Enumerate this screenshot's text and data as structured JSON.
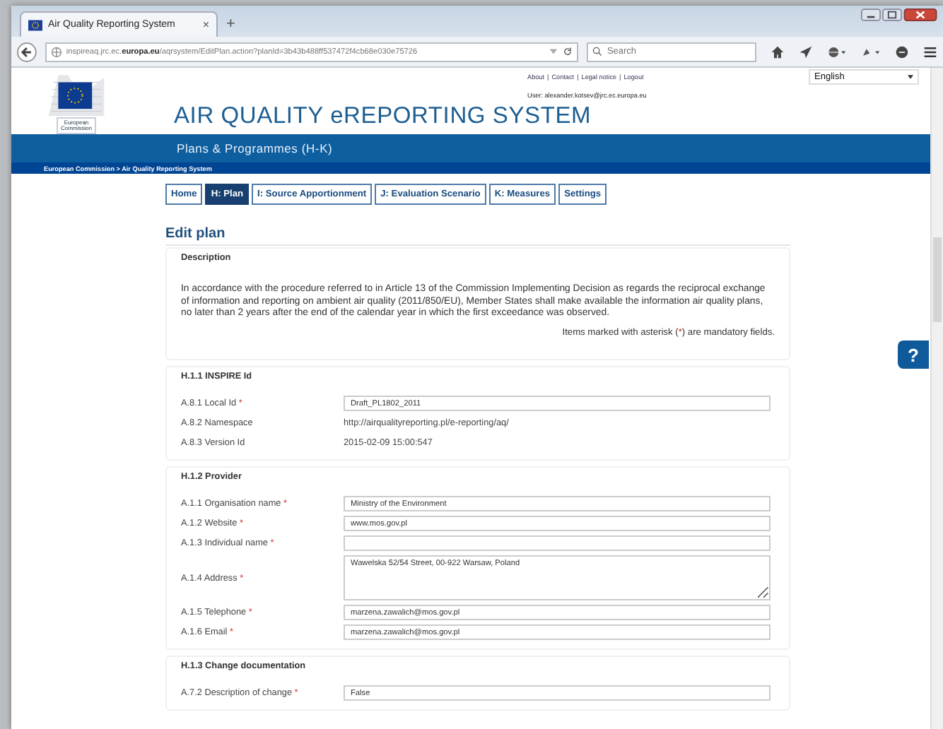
{
  "browser": {
    "tab_title": "Air Quality Reporting System",
    "tab_close": "×",
    "new_tab": "+",
    "url": "inspireaq.jrc.ec.**europa.eu**/aqrsystem/EditPlan.action?planId=3b43b488ff537472f4cb68e030e75726",
    "search_placeholder": "Search"
  },
  "header": {
    "links": [
      "About",
      "Contact",
      "Legal notice",
      "Logout"
    ],
    "link_separator": "|",
    "user": "User: alexander.kotsev@jrc.ec.europa.eu",
    "language": "English",
    "logo_text": "European Commission",
    "title": "AIR QUALITY eREPORTING SYSTEM",
    "subtitle": "Plans & Programmes (H-K)",
    "breadcrumb": "European Commission > Air Quality Reporting System"
  },
  "nav_tabs": [
    {
      "label": "Home",
      "selected": false
    },
    {
      "label": "H: Plan",
      "selected": true
    },
    {
      "label": "I: Source Apportionment",
      "selected": false
    },
    {
      "label": "J: Evaluation Scenario",
      "selected": false
    },
    {
      "label": "K: Measures",
      "selected": false
    },
    {
      "label": "Settings",
      "selected": false
    }
  ],
  "page_title": "Edit plan",
  "required_mark": "*",
  "sections": [
    {
      "kind": "text",
      "title": "Description",
      "paragraph": "In accordance with the procedure referred to in Article 13 of the Commission Implementing Decision as regards the reciprocal exchange of information and reporting on ambient air quality (2011/850/EU), Member States shall make available the information air quality plans, no later than 2 years after the end of the calendar year in which the first exceedance was observed.",
      "note": [
        "Items marked with asterisk (",
        "*",
        ") are mandatory fields."
      ]
    },
    {
      "kind": "fields",
      "title": "H.1.1 INSPIRE Id",
      "rows": [
        {
          "label": "A.8.1 Local Id",
          "required": true,
          "kind": "input",
          "value": "Draft_PL1802_2011"
        },
        {
          "label": "A.8.2 Namespace",
          "required": false,
          "kind": "static",
          "value": "http://airqualityreporting.pl/e-reporting/aq/"
        },
        {
          "label": "A.8.3 Version Id",
          "required": false,
          "kind": "static",
          "value": "2015-02-09 15:00:547"
        }
      ]
    },
    {
      "kind": "fields",
      "title": "H.1.2 Provider",
      "rows": [
        {
          "label": "A.1.1 Organisation name",
          "required": true,
          "kind": "input",
          "value": "Ministry of the Environment"
        },
        {
          "label": "A.1.2 Website",
          "required": true,
          "kind": "input",
          "value": "www.mos.gov.pl"
        },
        {
          "label": "A.1.3 Individual name",
          "required": true,
          "kind": "input"
        },
        {
          "label": "A.1.4 Address",
          "required": true,
          "kind": "textarea",
          "value": "Wawelska 52/54 Street, 00-922 Warsaw, Poland"
        },
        {
          "label": "A.1.5 Telephone",
          "required": true,
          "kind": "input",
          "value": "marzena.zawalich@mos.gov.pl"
        },
        {
          "label": "A.1.6 Email",
          "required": true,
          "kind": "input",
          "value": "marzena.zawalich@mos.gov.pl"
        }
      ]
    },
    {
      "kind": "fields",
      "title": "H.1.3 Change documentation",
      "rows": [
        {
          "label": "A.7.2 Description of change",
          "required": true,
          "kind": "input",
          "value": "False"
        }
      ]
    }
  ],
  "help_button": "?"
}
